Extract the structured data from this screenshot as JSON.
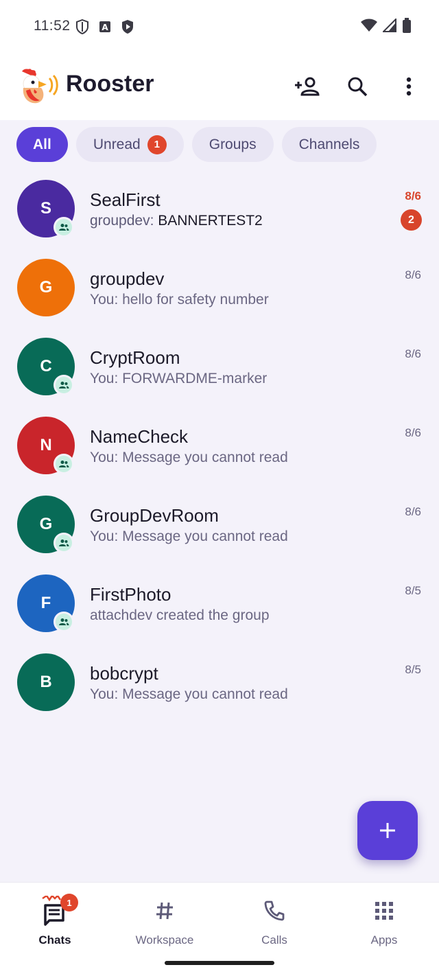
{
  "status_bar": {
    "time": "11:52"
  },
  "app": {
    "title": "Rooster"
  },
  "filters": {
    "all": "All",
    "unread": "Unread",
    "unread_count": "1",
    "groups": "Groups",
    "channels": "Channels"
  },
  "chats": [
    {
      "initial": "S",
      "name": "SealFirst",
      "sender": "groupdev:",
      "preview": "BANNERTEST2",
      "date": "8/6",
      "unread": "2",
      "color": "#4a2aa0",
      "group": true
    },
    {
      "initial": "G",
      "name": "groupdev",
      "preview": "You: hello for safety number",
      "date": "8/6",
      "color": "#ee7009",
      "group": false
    },
    {
      "initial": "C",
      "name": "CryptRoom",
      "preview": "You: FORWARDME-marker",
      "date": "8/6",
      "color": "#086b57",
      "group": true
    },
    {
      "initial": "N",
      "name": "NameCheck",
      "preview": "You: Message you cannot read",
      "date": "8/6",
      "color": "#c9252b",
      "group": true
    },
    {
      "initial": "G",
      "name": "GroupDevRoom",
      "preview": "You: Message you cannot read",
      "date": "8/6",
      "color": "#086b57",
      "group": true
    },
    {
      "initial": "F",
      "name": "FirstPhoto",
      "preview": "attachdev created the group",
      "date": "8/5",
      "color": "#1d65c0",
      "group": true
    },
    {
      "initial": "B",
      "name": "bobcrypt",
      "preview": "You: Message you cannot read",
      "date": "8/5",
      "color": "#086b57",
      "group": false
    }
  ],
  "bottom_nav": {
    "chats": "Chats",
    "chats_badge": "1",
    "workspace": "Workspace",
    "calls": "Calls",
    "apps": "Apps"
  },
  "colors": {
    "accent": "#5a3fd8",
    "badge": "#e0462c"
  }
}
